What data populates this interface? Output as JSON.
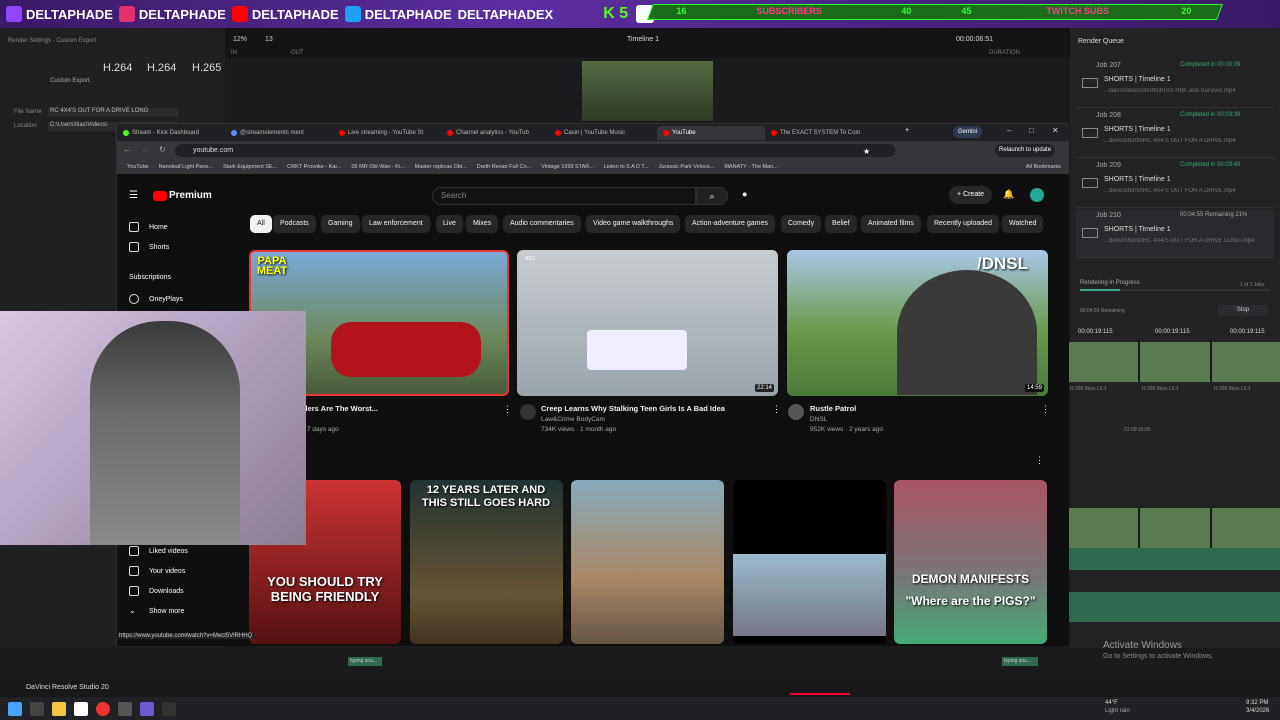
{
  "banner": {
    "handles": [
      "DELTAPHADE",
      "DELTAPHADE",
      "DELTAPHADE",
      "DELTAPHADE",
      "DELTAPHADEX"
    ],
    "kick": "K 5",
    "subs_current": "16",
    "subs_label": "SUBSCRIBERS",
    "subs_goal": "40",
    "twitch_current": "45",
    "twitch_label": "TWITCH SUBS",
    "twitch_goal": "20"
  },
  "resolve": {
    "left_title": "Render Settings - Custom Export",
    "custom_export": "Custom Export",
    "codecs": [
      "H.264",
      "H.264",
      "H.265"
    ],
    "codec_sub": [
      "H.264 Master",
      "HyperDeck",
      "H.265 Master"
    ],
    "file_name_label": "File Name",
    "file_name": "RC 4X4'S OUT FOR A DRIVE LONG",
    "location_label": "Location",
    "location": "C:\\Users\\Ilias\\Videos\\",
    "zoom": "12%",
    "zoom2": "13",
    "timeline": "Timeline 1",
    "timecode": "00:00:06:51",
    "in": "IN",
    "out": "OUT",
    "duration": "DURATION",
    "render_queue": "Render Queue",
    "jobs": [
      {
        "n": "Job 207",
        "s": "Completed in 00:00:09",
        "t": "SHORTS | Timeline 1",
        "p": "...ilias\\Videos\\Shorts\\KISS HIM Jedi Survivor.mp4"
      },
      {
        "n": "Job 208",
        "s": "Completed in 00:03:39",
        "t": "SHORTS | Timeline 1",
        "p": "...dens\\Shorts\\RC 4X4'S OUT FOR A DRIVE.mp4"
      },
      {
        "n": "Job 209",
        "s": "Completed in 00:03:43",
        "t": "SHORTS | Timeline 1",
        "p": "...dens\\Shorts\\RC 4X4'S OUT FOR A DRIVE.mp4"
      },
      {
        "n": "Job 210",
        "s": "00:04:55 Remaining  21%",
        "t": "SHORTS | Timeline 1",
        "p": "...dens\\Shorts\\RC 4X4'S OUT FOR A DRIVE LONG.mp4"
      }
    ],
    "rendering": "Rendering in Progress",
    "of_jobs": "1 of 1 Jobs",
    "remaining": "00:04:59 Remaining",
    "stop": "Stop",
    "tc1": "00:00:19:115",
    "tc2": "00:00:19:115",
    "tc3": "00:00:19:115",
    "tc4": "01:00:16:00",
    "clip_labels": [
      "H.265 Main L5.1",
      "H.265 Main L5.1",
      "H.265 Main L5.1"
    ],
    "activate": "Activate Windows",
    "activate_sub": "Go to Settings to activate Windows.",
    "app": "DaVinci Resolve Studio 20",
    "typing": "typing sou..."
  },
  "chrome": {
    "tabs": [
      "Stream - Kick Dashboard",
      "@streamelements ment",
      "Live streaming - YouTube St",
      "Channel analytics - YouTub",
      "Casin | YouTube Music",
      "YouTube",
      "The EXACT SYSTEM To Colo"
    ],
    "gemini": "Gemini",
    "url": "youtube.com",
    "relaunch": "Relaunch to update",
    "bookmarks": [
      "YouTube",
      "Nanoleaf Light Pane...",
      "Stark Equipment SE...",
      "CRKT Provoke - Kar...",
      "06 MR Obi Wan - Ki...",
      "Master replicas Obi...",
      "Darth Revan Full Co...",
      "Vintage 1999 STAR...",
      "Listen to S A D T...",
      "Jurassic Park Veloce...",
      "MANATY - The Man..."
    ],
    "all_bookmarks": "All Bookmarks",
    "status_url": "https://www.youtube.com/watch?v=Mect5VlRHHQ"
  },
  "youtube": {
    "logo": "Premium",
    "search_placeholder": "Search",
    "create": "Create",
    "nav": {
      "home": "Home",
      "shorts": "Shorts",
      "subscriptions": "Subscriptions",
      "oneyplays": "OneyPlays",
      "liked": "Liked videos",
      "yours": "Your videos",
      "downloads": "Downloads",
      "more": "Show more"
    },
    "chips": [
      "All",
      "Podcasts",
      "Gaming",
      "Law enforcement",
      "Live",
      "Mixes",
      "Audio commentaries",
      "Video game walkthroughs",
      "Action-adventure games",
      "Comedy",
      "Belief",
      "Animated films",
      "Recently uploaded",
      "Watched"
    ],
    "videos": [
      {
        "title": "ders Are The Worst...",
        "meta": "· 7 days ago",
        "overlay": "PAPA MEAT",
        "dur": ""
      },
      {
        "title": "Creep Learns Why Stalking Teen Girls Is A Bad Idea",
        "channel": "Law&Crime BodyCam",
        "meta": "734K views · 1 month ago",
        "dur": "22:14",
        "rec": "REC"
      },
      {
        "title": "Rustle Patrol",
        "channel": "DNSL",
        "meta": "952K views · 2 years ago",
        "dur": "14:59",
        "overlay": "/DNSL"
      }
    ],
    "row2": [
      {
        "overlay": "YOU SHOULD TRY BEING FRIENDLY"
      },
      {
        "overlay": "12 YEARS LATER AND THIS STILL GOES HARD"
      },
      {
        "overlay": ""
      },
      {
        "overlay": ""
      },
      {
        "overlay": "DEMON MANIFESTS \"Where are the PIGS?\""
      }
    ]
  },
  "taskbar": {
    "weather": "44°F",
    "weather_sub": "Light rain",
    "time": "9:32 PM",
    "date": "3/4/2026"
  }
}
